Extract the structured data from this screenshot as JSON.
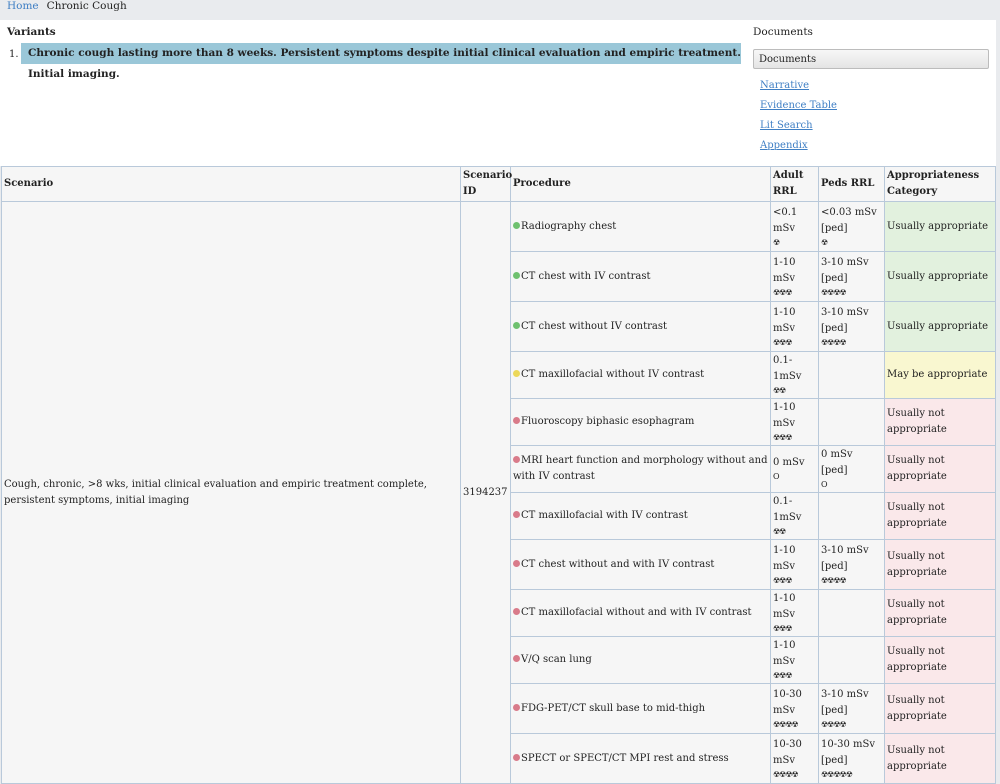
{
  "breadcrumb": {
    "home": "Home",
    "current": "Chronic Cough"
  },
  "variants": {
    "heading": "Variants",
    "items": [
      {
        "num": "1.",
        "text": "Chronic cough lasting more than 8 weeks. Persistent symptoms despite initial clinical evaluation and empiric treatment. Initial imaging."
      }
    ]
  },
  "documents": {
    "heading": "Documents",
    "select_value": "Documents",
    "links": [
      "Narrative",
      "Evidence Table",
      "Lit Search",
      "Appendix"
    ]
  },
  "table": {
    "headers": {
      "scenario": "Scenario",
      "scenario_id": "Scenario ID",
      "procedure": "Procedure",
      "adult_rrl": "Adult RRL",
      "peds_rrl": "Peds RRL",
      "category": "Appropriateness Category"
    },
    "scenario": "Cough, chronic, >8 wks, initial clinical evaluation and empiric treatment complete, persistent symptoms, initial imaging",
    "scenario_id": "3194237",
    "rows": [
      {
        "procedure": "Radiography chest",
        "adult": "<0.1 mSv",
        "adult_sym": "☢",
        "peds": "<0.03 mSv [ped]",
        "peds_sym": "☢",
        "category": "Usually appropriate",
        "level": "ua"
      },
      {
        "procedure": "CT chest with IV contrast",
        "adult": "1-10 mSv",
        "adult_sym": "☢☢☢",
        "peds": "3-10 mSv [ped]",
        "peds_sym": "☢☢☢☢",
        "category": "Usually appropriate",
        "level": "ua"
      },
      {
        "procedure": "CT chest without IV contrast",
        "adult": "1-10 mSv",
        "adult_sym": "☢☢☢",
        "peds": "3-10 mSv [ped]",
        "peds_sym": "☢☢☢☢",
        "category": "Usually appropriate",
        "level": "ua"
      },
      {
        "procedure": "CT maxillofacial without IV contrast",
        "adult": "0.1-1mSv",
        "adult_sym": "☢☢",
        "peds": "",
        "peds_sym": "",
        "category": "May be appropriate",
        "level": "ma"
      },
      {
        "procedure": "Fluoroscopy biphasic esophagram",
        "adult": "1-10 mSv",
        "adult_sym": "☢☢☢",
        "peds": "",
        "peds_sym": "",
        "category": "Usually not appropriate",
        "level": "una"
      },
      {
        "procedure": "MRI heart function and morphology without and with IV contrast",
        "adult": "0 mSv",
        "adult_sym": "O",
        "peds": "0 mSv [ped]",
        "peds_sym": "O",
        "category": "Usually not appropriate",
        "level": "una"
      },
      {
        "procedure": "CT maxillofacial with IV contrast",
        "adult": "0.1-1mSv",
        "adult_sym": "☢☢",
        "peds": "",
        "peds_sym": "",
        "category": "Usually not appropriate",
        "level": "una"
      },
      {
        "procedure": "CT chest without and with IV contrast",
        "adult": "1-10 mSv",
        "adult_sym": "☢☢☢",
        "peds": "3-10 mSv [ped]",
        "peds_sym": "☢☢☢☢",
        "category": "Usually not appropriate",
        "level": "una"
      },
      {
        "procedure": "CT maxillofacial without and with IV contrast",
        "adult": "1-10 mSv",
        "adult_sym": "☢☢☢",
        "peds": "",
        "peds_sym": "",
        "category": "Usually not appropriate",
        "level": "una"
      },
      {
        "procedure": "V/Q scan lung",
        "adult": "1-10 mSv",
        "adult_sym": "☢☢☢",
        "peds": "",
        "peds_sym": "",
        "category": "Usually not appropriate",
        "level": "una"
      },
      {
        "procedure": "FDG-PET/CT skull base to mid-thigh",
        "adult": "10-30 mSv",
        "adult_sym": "☢☢☢☢",
        "peds": "3-10 mSv [ped]",
        "peds_sym": "☢☢☢☢",
        "category": "Usually not appropriate",
        "level": "una"
      },
      {
        "procedure": "SPECT or SPECT/CT MPI rest and stress",
        "adult": "10-30 mSv",
        "adult_sym": "☢☢☢☢",
        "peds": "10-30 mSv [ped]",
        "peds_sym": "☢☢☢☢☢",
        "category": "Usually not appropriate",
        "level": "una"
      }
    ]
  }
}
